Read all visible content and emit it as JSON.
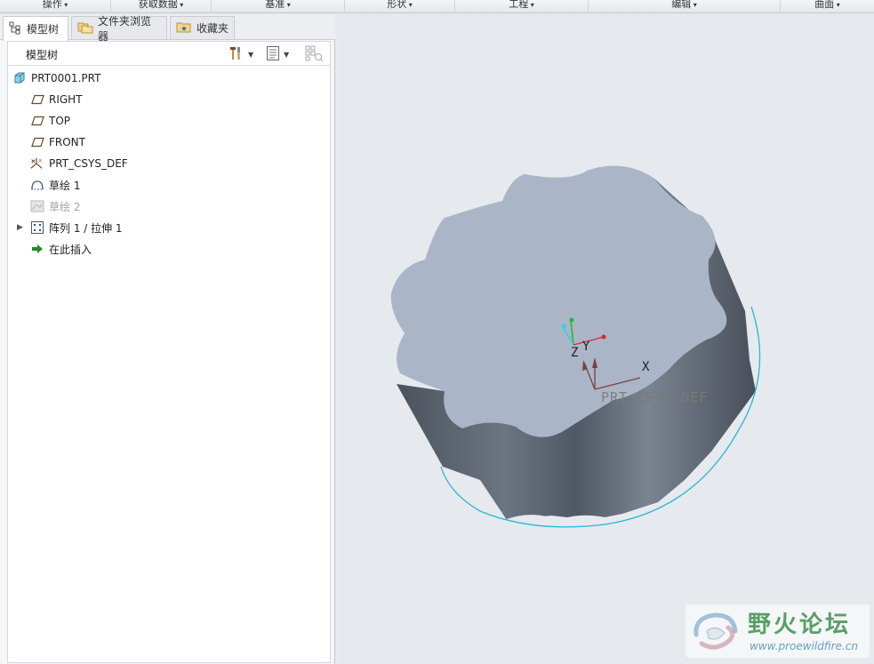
{
  "ribbon": {
    "groups": [
      "操作",
      "获取数据",
      "基准",
      "形状",
      "工程",
      "编辑",
      "曲面"
    ]
  },
  "tabs": [
    {
      "label": "模型树",
      "icon": "model-tree-icon",
      "active": true
    },
    {
      "label": "文件夹浏览器",
      "icon": "folder-browser-icon",
      "active": false
    },
    {
      "label": "收藏夹",
      "icon": "favorites-icon",
      "active": false
    }
  ],
  "tree": {
    "title": "模型树",
    "nodes": [
      {
        "label": "PRT0001.PRT",
        "icon": "part-icon"
      },
      {
        "label": "RIGHT",
        "icon": "datum-plane-icon"
      },
      {
        "label": "TOP",
        "icon": "datum-plane-icon"
      },
      {
        "label": "FRONT",
        "icon": "datum-plane-icon"
      },
      {
        "label": "PRT_CSYS_DEF",
        "icon": "coordinate-system-icon"
      },
      {
        "label": "草绘 1",
        "icon": "sketch-icon"
      },
      {
        "label": "草绘 2",
        "icon": "sketch-icon",
        "dim": true
      },
      {
        "label": "阵列 1 / 拉伸 1",
        "icon": "pattern-icon",
        "expandable": true
      },
      {
        "label": "在此插入",
        "icon": "insert-here-arrow-icon"
      }
    ]
  },
  "viewport": {
    "csys_label": "PRT_CSYS_DEF",
    "axis_x": "X",
    "axis_y": "Y",
    "axis_z": "Z",
    "colors": {
      "top_face": "#aab6c7",
      "side_dark": "#4f5662",
      "side_light": "#7c8592",
      "sketch_circle": "#29b6d6",
      "csys_red": "#e0262a",
      "csys_green": "#27b33a",
      "csys_cyan": "#2bd4e0"
    }
  },
  "watermark": {
    "title": "野火论坛",
    "url": "www.proewildfire.cn"
  }
}
